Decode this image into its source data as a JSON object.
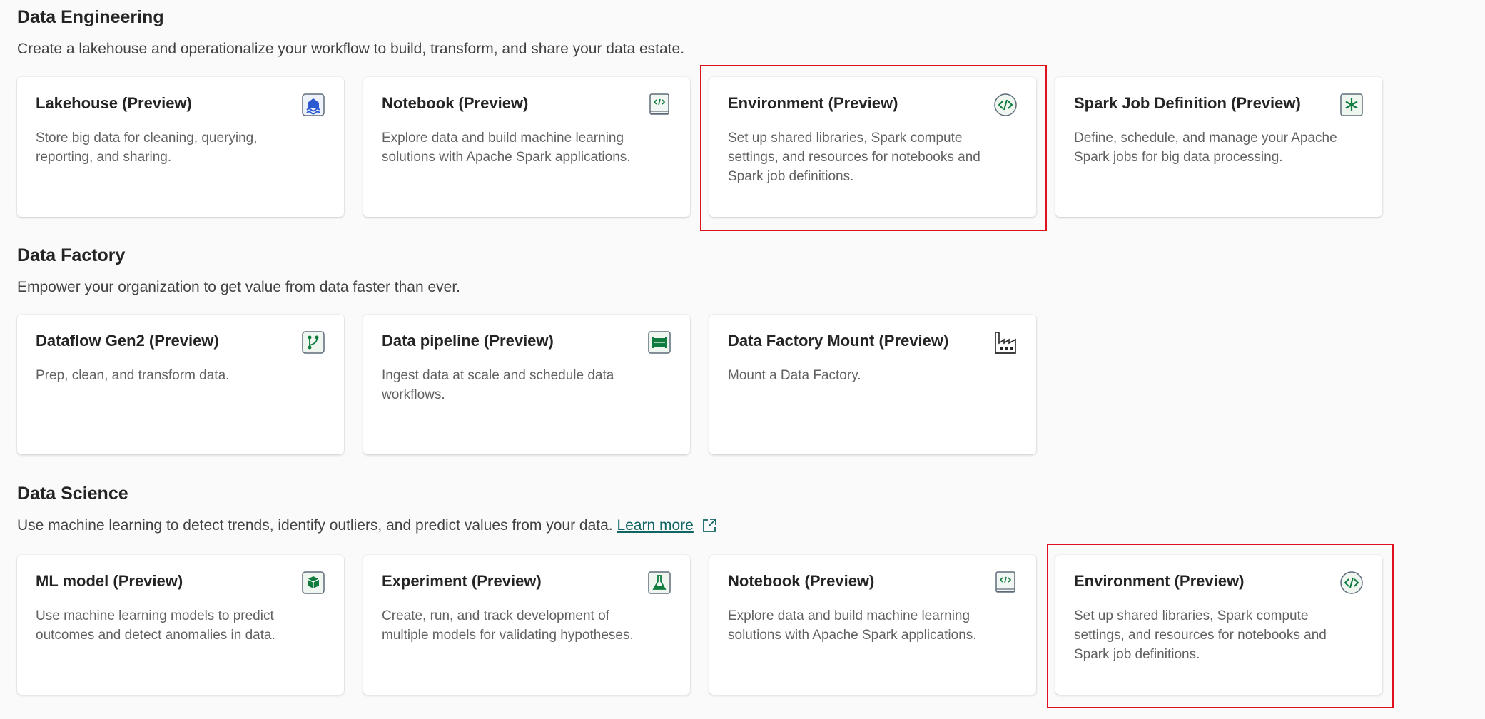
{
  "sections": {
    "data_engineering": {
      "title": "Data Engineering",
      "description": "Create a lakehouse and operationalize your workflow to build, transform, and share your data estate.",
      "cards": [
        {
          "title": "Lakehouse (Preview)",
          "description": "Store big data for cleaning, querying, reporting, and sharing.",
          "icon": "lakehouse-icon"
        },
        {
          "title": "Notebook (Preview)",
          "description": "Explore data and build machine learning solutions with Apache Spark applications.",
          "icon": "notebook-icon"
        },
        {
          "title": "Environment (Preview)",
          "description": "Set up shared libraries, Spark compute settings, and resources for notebooks and Spark job definitions.",
          "icon": "environment-icon"
        },
        {
          "title": "Spark Job Definition (Preview)",
          "description": "Define, schedule, and manage your Apache Spark jobs for big data processing.",
          "icon": "spark-job-icon"
        }
      ]
    },
    "data_factory": {
      "title": "Data Factory",
      "description": "Empower your organization to get value from data faster than ever.",
      "cards": [
        {
          "title": "Dataflow Gen2 (Preview)",
          "description": "Prep, clean, and transform data.",
          "icon": "dataflow-icon"
        },
        {
          "title": "Data pipeline (Preview)",
          "description": "Ingest data at scale and schedule data workflows.",
          "icon": "pipeline-icon"
        },
        {
          "title": "Data Factory Mount (Preview)",
          "description": "Mount a Data Factory.",
          "icon": "factory-icon"
        }
      ]
    },
    "data_science": {
      "title": "Data Science",
      "description": "Use machine learning to detect trends, identify outliers, and predict values from your data.",
      "learn_more": "Learn more",
      "cards": [
        {
          "title": "ML model (Preview)",
          "description": "Use machine learning models to predict outcomes and detect anomalies in data.",
          "icon": "ml-model-icon"
        },
        {
          "title": "Experiment (Preview)",
          "description": "Create, run, and track development of multiple models for validating hypotheses.",
          "icon": "experiment-icon"
        },
        {
          "title": "Notebook (Preview)",
          "description": "Explore data and build machine learning solutions with Apache Spark applications.",
          "icon": "notebook-icon"
        },
        {
          "title": "Environment (Preview)",
          "description": "Set up shared libraries, Spark compute settings, and resources for notebooks and Spark job definitions.",
          "icon": "environment-icon"
        }
      ]
    }
  },
  "colors": {
    "accent_green": "#0f7b3f",
    "link": "#0f6563",
    "highlight_border": "#e0101d"
  }
}
